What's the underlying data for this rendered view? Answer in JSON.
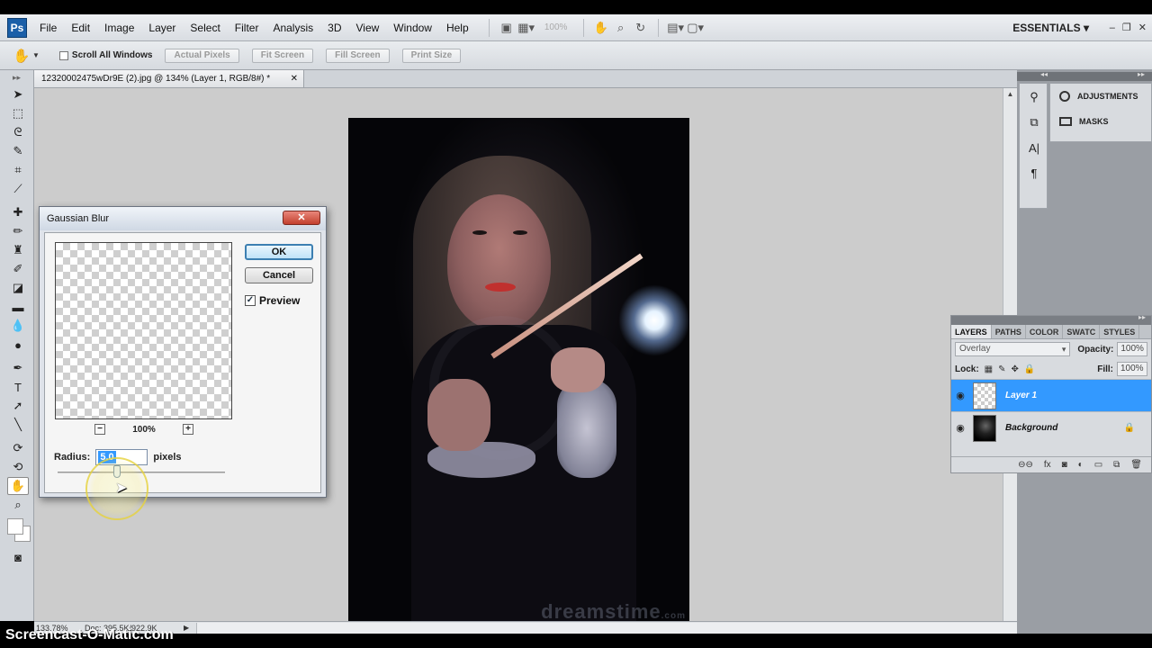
{
  "app": {
    "logo": "Ps",
    "menu": [
      "File",
      "Edit",
      "Image",
      "Layer",
      "Select",
      "Filter",
      "Analysis",
      "3D",
      "View",
      "Window",
      "Help"
    ],
    "zoom_box": "100%",
    "workspace": "ESSENTIALS"
  },
  "options_bar": {
    "scroll_all_windows": "Scroll All Windows",
    "buttons": [
      "Actual Pixels",
      "Fit Screen",
      "Fill Screen",
      "Print Size"
    ]
  },
  "document": {
    "tab_title": "12320002475wDr9E (2).jpg @ 134% (Layer 1, RGB/8#) *",
    "watermark": "dreamstime",
    "watermark_suffix": ".com",
    "status_zoom": "133.78%",
    "status_doc": "Doc: 395.5K/922.9K"
  },
  "right_panels": {
    "adjustments": "ADJUSTMENTS",
    "masks": "MASKS"
  },
  "layers_panel": {
    "tabs": [
      "LAYERS",
      "PATHS",
      "COLOR",
      "SWATC",
      "STYLES"
    ],
    "blend_mode": "Overlay",
    "opacity_label": "Opacity:",
    "opacity_value": "100%",
    "lock_label": "Lock:",
    "fill_label": "Fill:",
    "fill_value": "100%",
    "layers": [
      {
        "name": "Layer 1",
        "selected": true
      },
      {
        "name": "Background",
        "selected": false
      }
    ]
  },
  "dialog": {
    "title": "Gaussian Blur",
    "ok": "OK",
    "cancel": "Cancel",
    "preview_label": "Preview",
    "preview_checked": true,
    "zoom_level": "100%",
    "radius_label": "Radius:",
    "radius_value": "5.0",
    "radius_unit": "pixels"
  },
  "overlay": {
    "screencast_brand": "Screencast-O-Matic.com"
  }
}
